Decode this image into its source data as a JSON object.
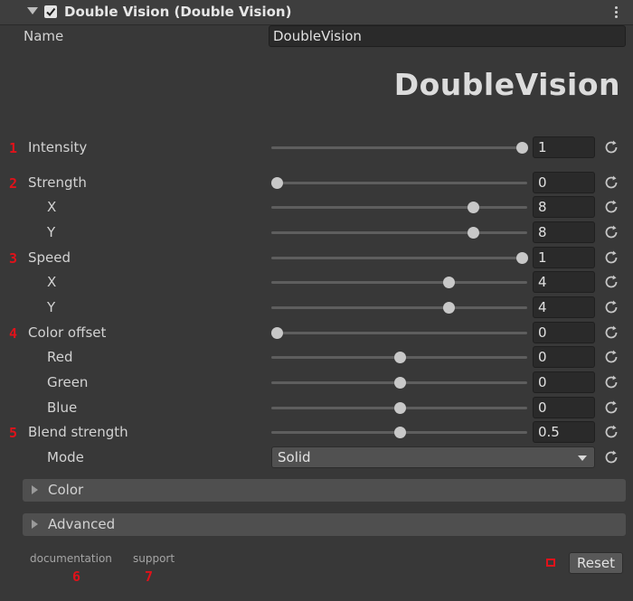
{
  "header": {
    "title": "Double Vision (Double Vision)",
    "enabled": true
  },
  "name_field": {
    "label": "Name",
    "value": "DoubleVision"
  },
  "logo_text": "DoubleVision",
  "markers": [
    "1",
    "2",
    "3",
    "4",
    "5",
    "6",
    "7"
  ],
  "params": [
    {
      "label": "Intensity",
      "value": "1",
      "fraction": 1.0
    },
    {
      "label": "Strength",
      "value": "0",
      "fraction": 0.0
    },
    {
      "label": "X",
      "value": "8",
      "fraction": 0.8
    },
    {
      "label": "Y",
      "value": "8",
      "fraction": 0.8
    },
    {
      "label": "Speed",
      "value": "1",
      "fraction": 1.0
    },
    {
      "label": "X",
      "value": "4",
      "fraction": 0.7
    },
    {
      "label": "Y",
      "value": "4",
      "fraction": 0.7
    },
    {
      "label": "Color offset",
      "value": "0",
      "fraction": 0.0
    },
    {
      "label": "Red",
      "value": "0",
      "fraction": 0.5
    },
    {
      "label": "Green",
      "value": "0",
      "fraction": 0.5
    },
    {
      "label": "Blue",
      "value": "0",
      "fraction": 0.5
    },
    {
      "label": "Blend strength",
      "value": "0.5",
      "fraction": 0.5
    }
  ],
  "mode": {
    "label": "Mode",
    "value": "Solid"
  },
  "foldouts": [
    "Color",
    "Advanced"
  ],
  "links": {
    "documentation": "documentation",
    "support": "support"
  },
  "reset_button": "Reset",
  "colors": {
    "background": "#383838",
    "marker_red": "#e0121a",
    "field": "#2a2a2a"
  }
}
